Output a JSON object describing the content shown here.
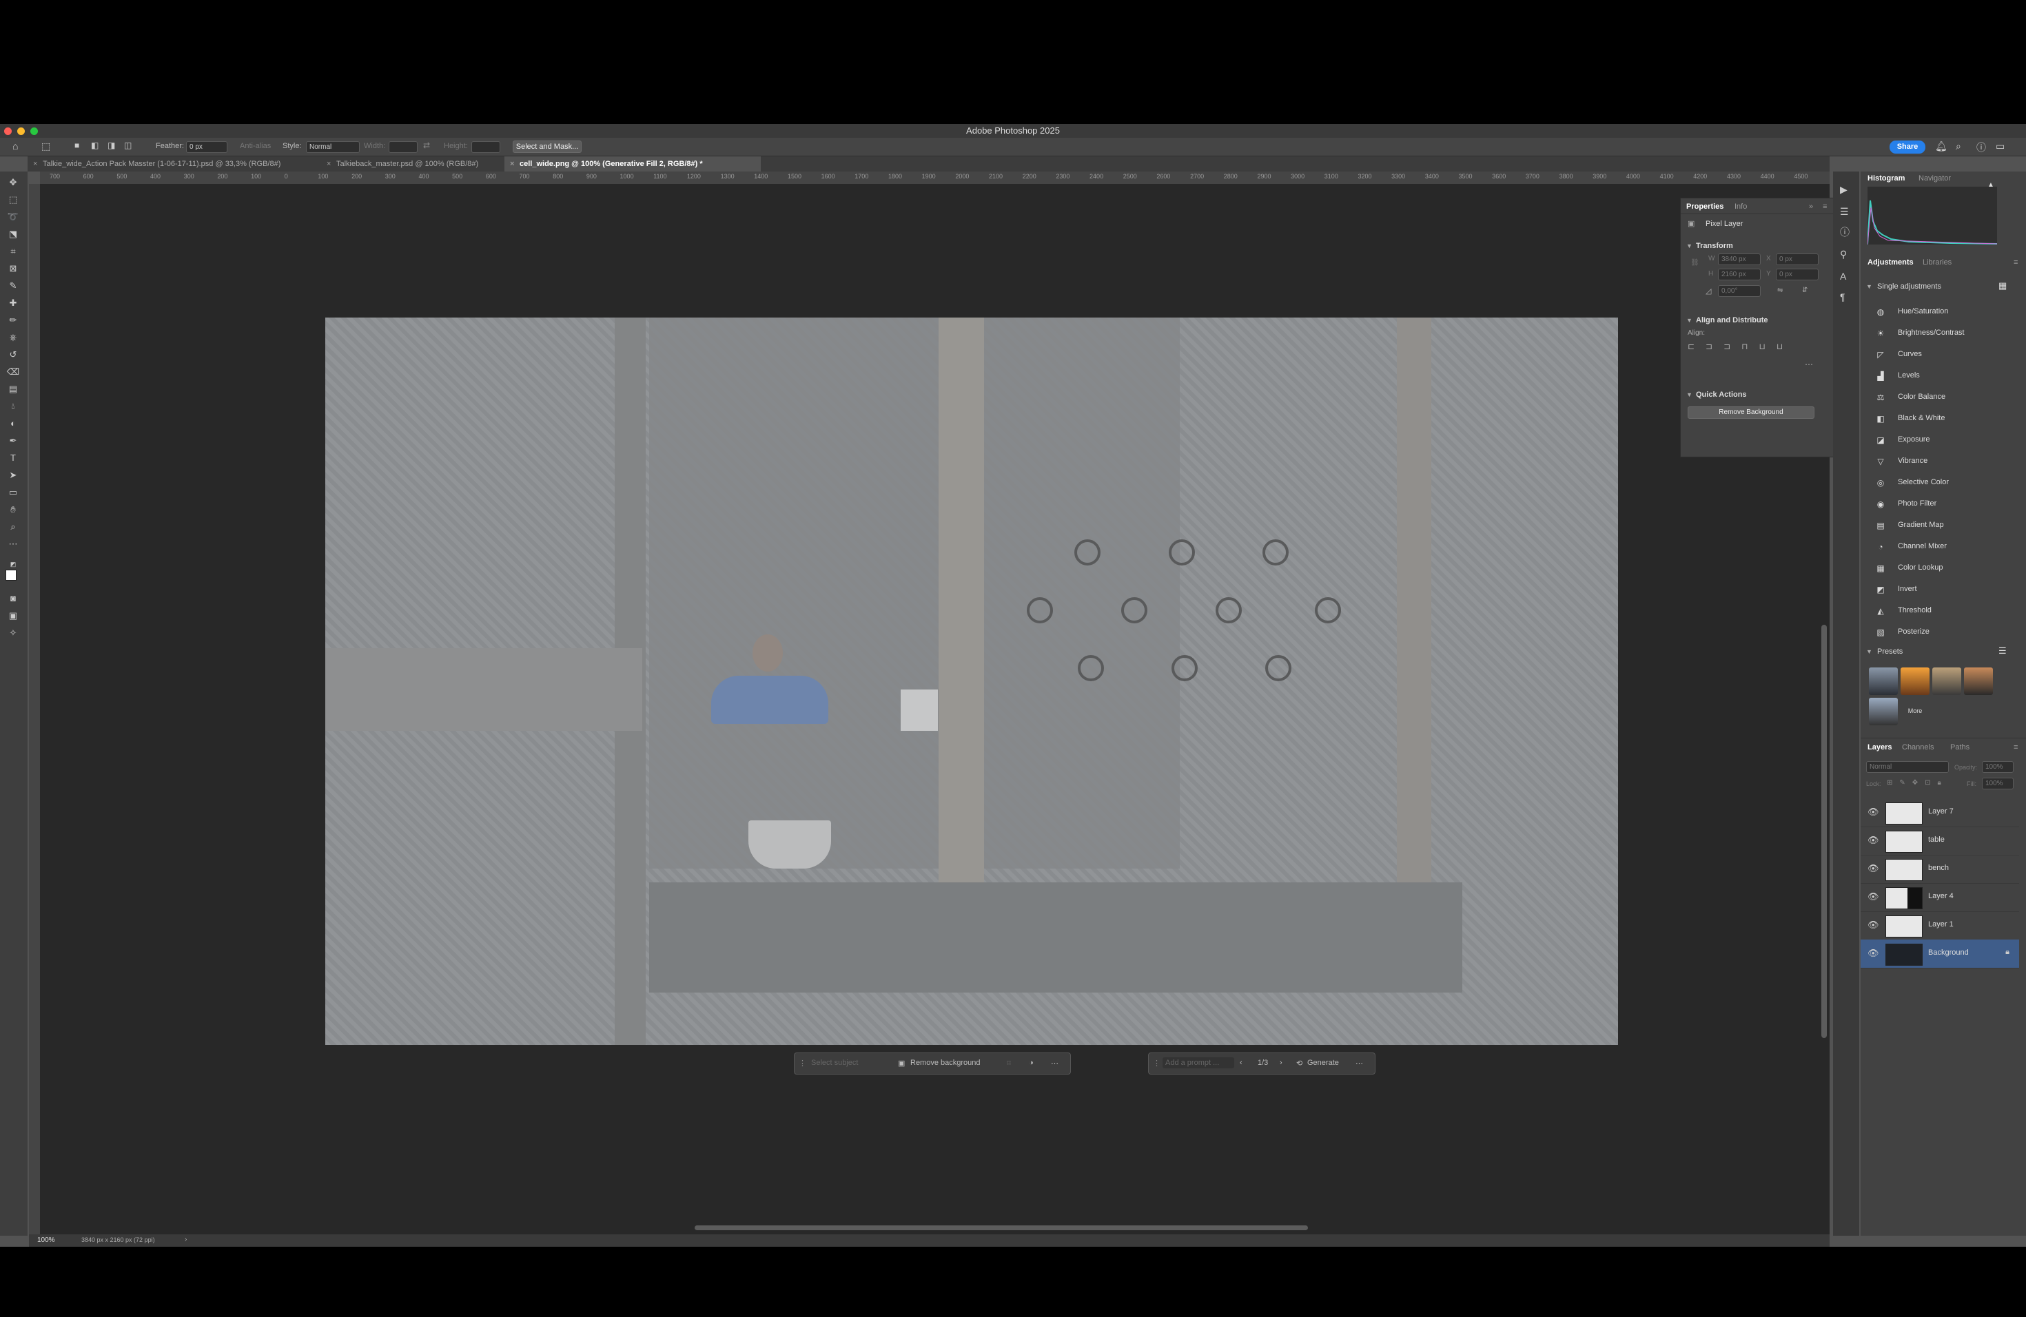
{
  "app": {
    "title": "Adobe Photoshop 2025",
    "traffic_colors": [
      "#ff5f57",
      "#febc2e",
      "#28c840"
    ],
    "accent": "#2680eb"
  },
  "options_bar": {
    "feather_label": "Feather:",
    "feather_value": "0 px",
    "anti_alias_label": "Anti-alias",
    "style_label": "Style:",
    "style_value": "Normal",
    "width_label": "Width:",
    "height_label": "Height:",
    "select_mask_label": "Select and Mask...",
    "share_label": "Share"
  },
  "tabs": [
    {
      "label": "Talkie_wide_Action Pack Masster (1-06-17-11).psd @ 33,3% (RGB/8#)",
      "active": false
    },
    {
      "label": "Talkieback_master.psd @ 100% (RGB/8#)",
      "active": false
    },
    {
      "label": "cell_wide.png @ 100% (Generative Fill 2, RGB/8#) *",
      "active": true
    }
  ],
  "ruler": {
    "labels": [
      "700",
      "600",
      "500",
      "400",
      "300",
      "200",
      "100",
      "0",
      "100",
      "200",
      "300",
      "400",
      "500",
      "600",
      "700",
      "800",
      "900",
      "1000",
      "1100",
      "1200",
      "1300",
      "1400",
      "1500",
      "1600",
      "1700",
      "1800",
      "1900",
      "2000",
      "2100",
      "2200",
      "2300",
      "2400",
      "2500",
      "2600",
      "2700",
      "2800",
      "2900",
      "3000",
      "3100",
      "3200",
      "3300",
      "3400",
      "3500",
      "3600",
      "3700",
      "3800",
      "3900",
      "4000",
      "4100",
      "4200",
      "4300",
      "4400",
      "4500"
    ]
  },
  "context_bar": {
    "select_subject": "Select subject",
    "remove_background": "Remove background"
  },
  "gen_bar": {
    "prompt_placeholder": "Add a prompt ...",
    "page_counter": "1/3",
    "generate_label": "Generate"
  },
  "status": {
    "zoom": "100%",
    "doc_info": "3840 px x 2160 px (72 ppi)"
  },
  "properties": {
    "tab_properties": "Properties",
    "tab_info": "Info",
    "layer_type": "Pixel Layer",
    "transform_label": "Transform",
    "w_label": "W",
    "w_value": "3840 px",
    "h_label": "H",
    "h_value": "2160 px",
    "x_label": "X",
    "x_value": "0 px",
    "y_label": "Y",
    "y_value": "0 px",
    "angle_value": "0,00°",
    "align_distribute_label": "Align and Distribute",
    "align_label": "Align:",
    "quick_actions_label": "Quick Actions",
    "remove_background_btn": "Remove Background"
  },
  "dock": {
    "tab_histogram": "Histogram",
    "tab_navigator": "Navigator",
    "tab_adjustments": "Adjustments",
    "tab_libraries": "Libraries",
    "single_adjustments_label": "Single adjustments",
    "adjustments": [
      {
        "label": "Hue/Saturation",
        "icon": "hue-icon"
      },
      {
        "label": "Brightness/Contrast",
        "icon": "brightness-icon"
      },
      {
        "label": "Curves",
        "icon": "curves-icon"
      },
      {
        "label": "Levels",
        "icon": "levels-icon"
      },
      {
        "label": "Color Balance",
        "icon": "color-balance-icon"
      },
      {
        "label": "Black & White",
        "icon": "black-white-icon"
      },
      {
        "label": "Exposure",
        "icon": "exposure-icon"
      },
      {
        "label": "Vibrance",
        "icon": "vibrance-icon"
      },
      {
        "label": "Selective Color",
        "icon": "selective-color-icon"
      },
      {
        "label": "Photo Filter",
        "icon": "photo-filter-icon"
      },
      {
        "label": "Gradient Map",
        "icon": "gradient-map-icon"
      },
      {
        "label": "Channel Mixer",
        "icon": "channel-mixer-icon"
      },
      {
        "label": "Color Lookup",
        "icon": "color-lookup-icon"
      },
      {
        "label": "Invert",
        "icon": "invert-icon"
      },
      {
        "label": "Threshold",
        "icon": "threshold-icon"
      },
      {
        "label": "Posterize",
        "icon": "posterize-icon"
      }
    ],
    "presets_label": "Presets",
    "more_label": "More"
  },
  "layers_panel": {
    "tab_layers": "Layers",
    "tab_channels": "Channels",
    "tab_paths": "Paths",
    "blend_mode": "Normal",
    "opacity_label": "Opacity:",
    "opacity_value": "100%",
    "lock_label": "Lock:",
    "fill_label": "Fill:",
    "fill_value": "100%",
    "layers": [
      {
        "name": "Layer 7",
        "selected": false
      },
      {
        "name": "table",
        "selected": false
      },
      {
        "name": "bench",
        "selected": false
      },
      {
        "name": "Layer 4",
        "selected": false
      },
      {
        "name": "Layer 1",
        "selected": false
      },
      {
        "name": "Background",
        "selected": true,
        "locked": true
      }
    ]
  }
}
